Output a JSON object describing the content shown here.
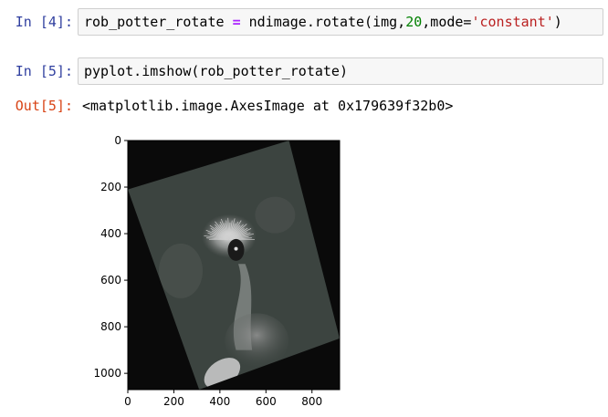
{
  "cells": [
    {
      "prompt": "In [4]:",
      "code": {
        "var": "rob_potter_rotate",
        "eq": "=",
        "call": "ndimage.rotate(img,",
        "angle": "20",
        "sep": ",mode=",
        "mode": "'constant'",
        "close": ")"
      }
    },
    {
      "prompt": "In [5]:",
      "code": {
        "text": "pyplot.imshow(rob_potter_rotate)"
      }
    }
  ],
  "output": {
    "prompt": "Out[5]:",
    "text": "<matplotlib.image.AxesImage at 0x179639f32b0>"
  },
  "chart_data": {
    "type": "image",
    "title": "",
    "xlabel": "",
    "ylabel": "",
    "xlim": [
      0,
      920
    ],
    "ylim": [
      1070,
      0
    ],
    "xticks": [
      0,
      200,
      400,
      600,
      800
    ],
    "yticks": [
      0,
      200,
      400,
      600,
      800,
      1000
    ],
    "rotated_image_corners": [
      [
        0,
        210
      ],
      [
        700,
        0
      ],
      [
        920,
        850
      ],
      [
        310,
        1070
      ]
    ],
    "colors": {
      "background": "#0a0a0a",
      "image_fill": "#3c4440",
      "highlight": "#d0d0d0"
    }
  }
}
